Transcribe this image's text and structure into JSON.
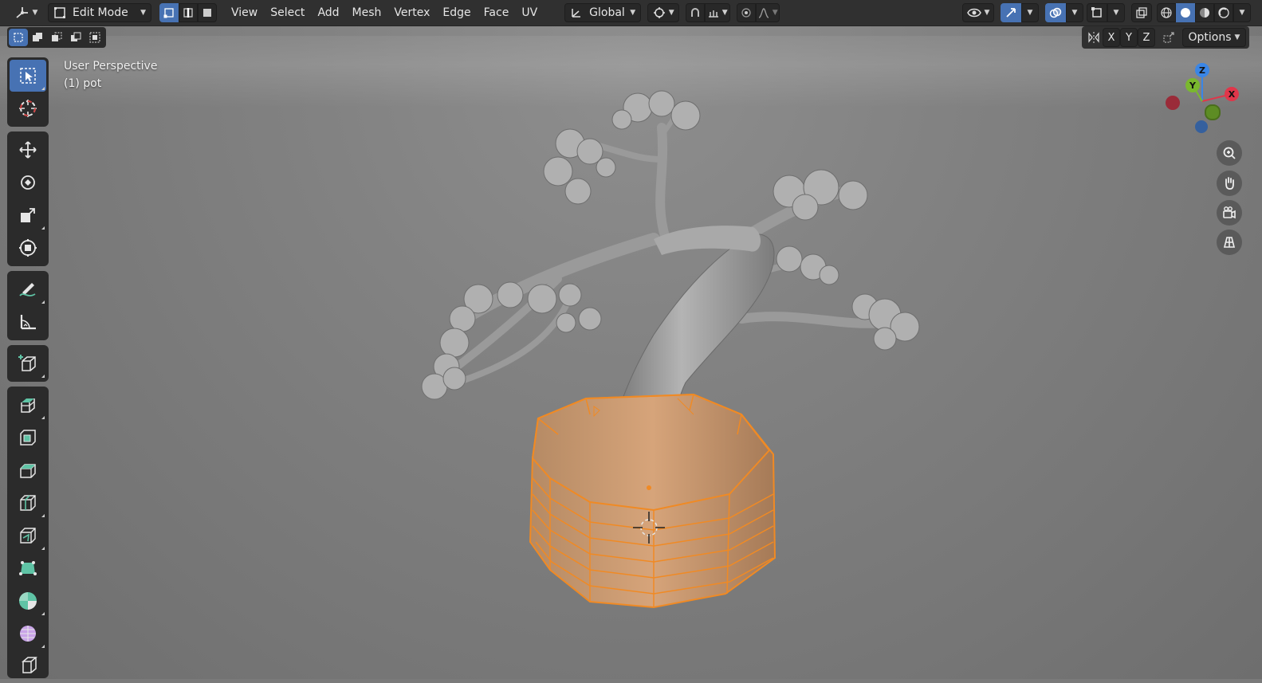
{
  "header": {
    "mode_label": "Edit Mode",
    "menus": [
      "View",
      "Select",
      "Add",
      "Mesh",
      "Vertex",
      "Edge",
      "Face",
      "UV"
    ],
    "orientation_label": "Global"
  },
  "subbar": {
    "axis_labels": [
      "X",
      "Y",
      "Z"
    ],
    "options_label": "Options"
  },
  "viewport": {
    "view_name": "User Perspective",
    "object_name": "(1) pot"
  },
  "gizmo": {
    "x_label": "X",
    "y_label": "Y",
    "z_label": "Z",
    "colors": {
      "x": "#e0364a",
      "y": "#7ab82e",
      "z": "#3a86e6"
    }
  },
  "colors": {
    "accent": "#4772b3",
    "selection": "#f08a24",
    "header_bg": "#303030"
  },
  "toolbar": {
    "tools": [
      "select-box",
      "cursor",
      "move",
      "rotate",
      "scale",
      "transform",
      "annotate",
      "measure",
      "add-cube",
      "extrude",
      "inset",
      "bevel",
      "loop-cut",
      "knife",
      "poly-build",
      "spin",
      "smooth",
      "shear"
    ]
  }
}
